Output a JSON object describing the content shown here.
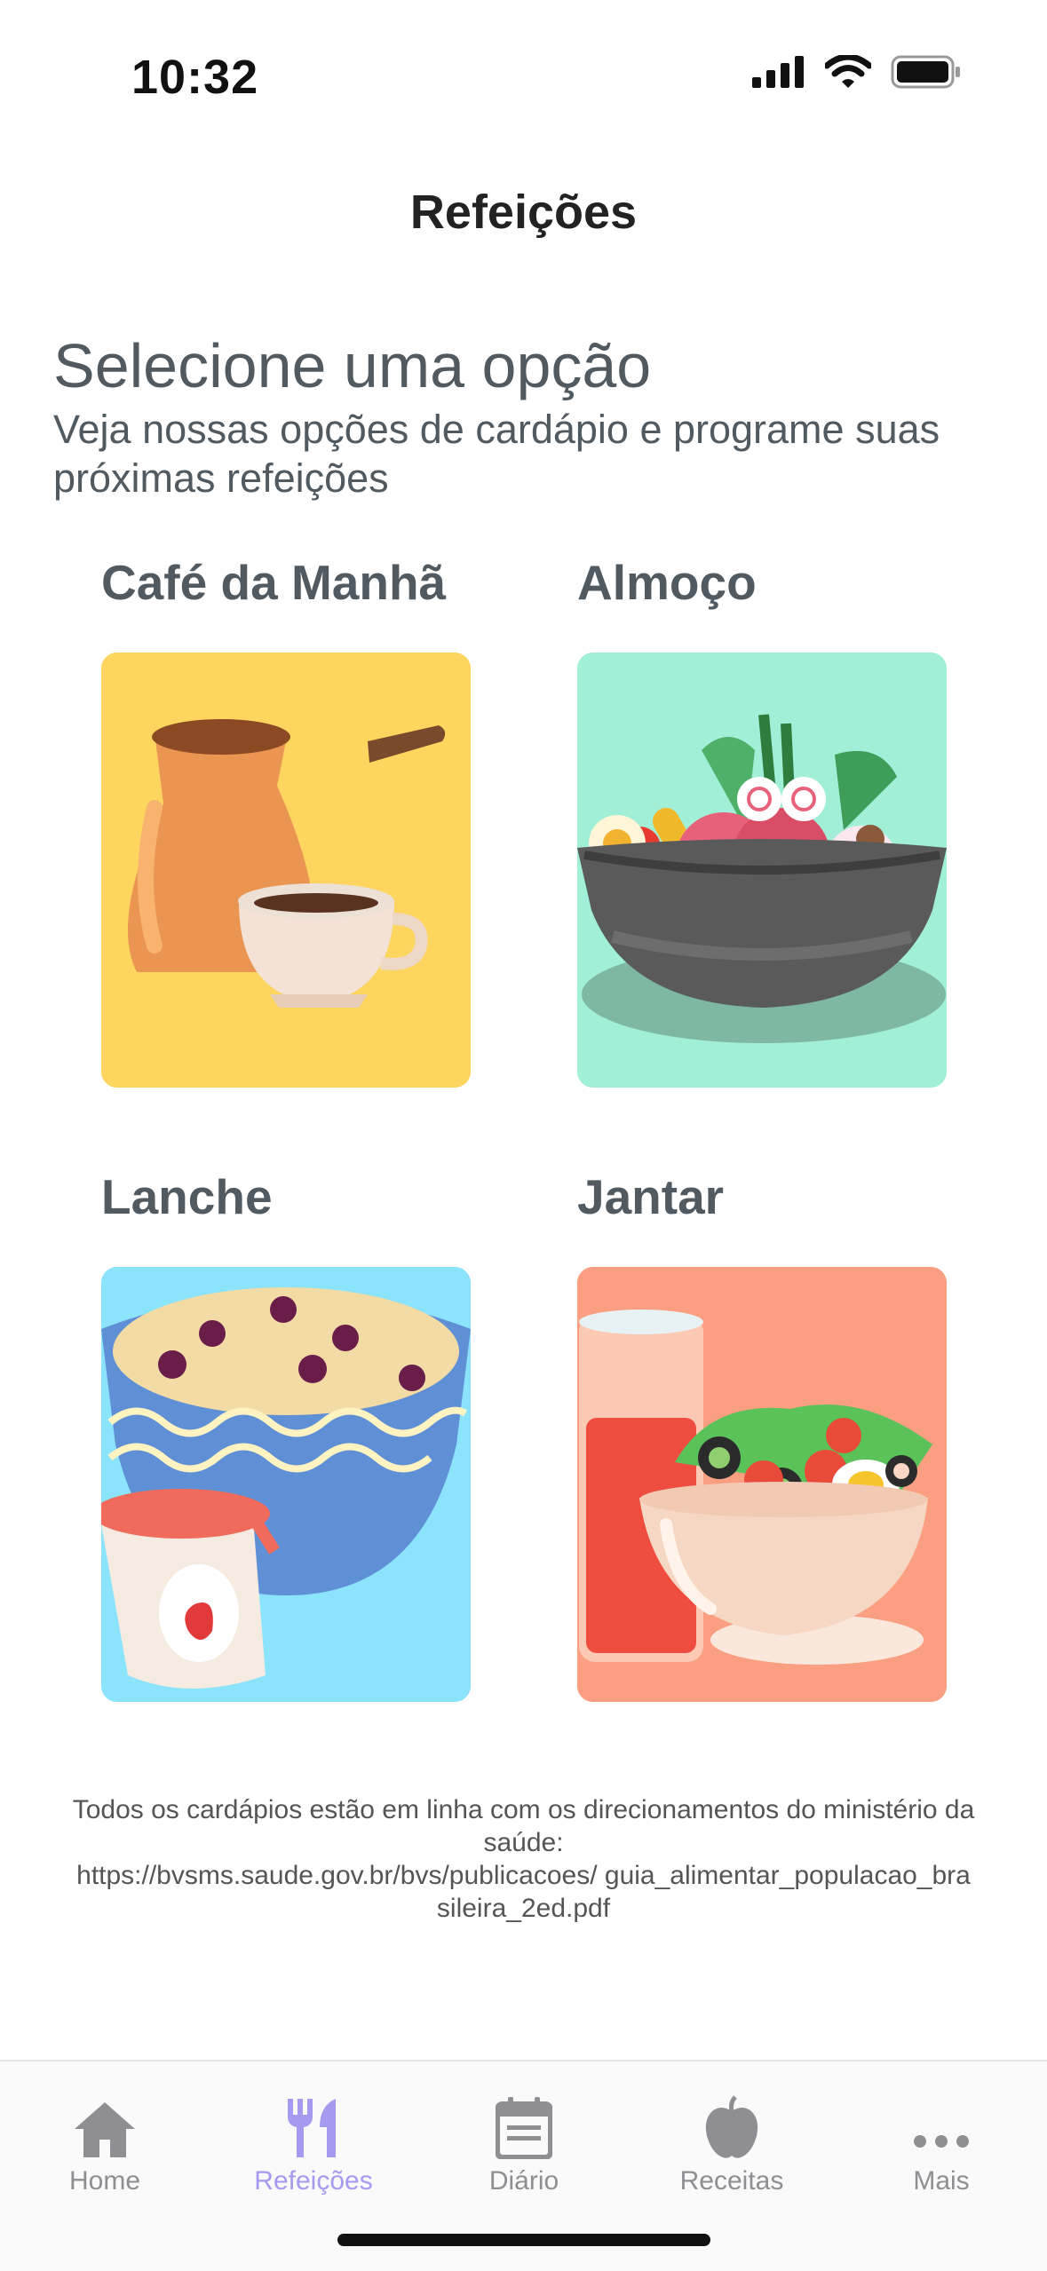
{
  "status_bar": {
    "time": "10:32"
  },
  "header": {
    "title": "Refeições"
  },
  "intro": {
    "heading": "Selecione uma opção",
    "subtitle": "Veja nossas opções de cardápio e programe suas próximas refeições"
  },
  "meals": [
    {
      "label": "Café da Manhã",
      "bg": "#fdd55f"
    },
    {
      "label": "Almoço",
      "bg": "#a1efd6"
    },
    {
      "label": "Lanche",
      "bg": "#8be3fc"
    },
    {
      "label": "Jantar",
      "bg": "#fb9f82"
    }
  ],
  "footer": {
    "note": "Todos os cardápios estão em linha com os direcionamentos do ministério da saúde:",
    "url": "https://bvsms.saude.gov.br/bvs/publicacoes/ guia_alimentar_populacao_brasileira_2ed.pdf"
  },
  "tabs": [
    {
      "label": "Home",
      "icon": "house-icon"
    },
    {
      "label": "Refeições",
      "icon": "fork-knife-icon",
      "active": true
    },
    {
      "label": "Diário",
      "icon": "calendar-icon"
    },
    {
      "label": "Receitas",
      "icon": "apple-icon"
    },
    {
      "label": "Mais",
      "icon": "more-dots-icon"
    }
  ],
  "colors": {
    "accent": "#a49af0",
    "text": "#505a60",
    "inactive_tab": "#8e8e93"
  }
}
